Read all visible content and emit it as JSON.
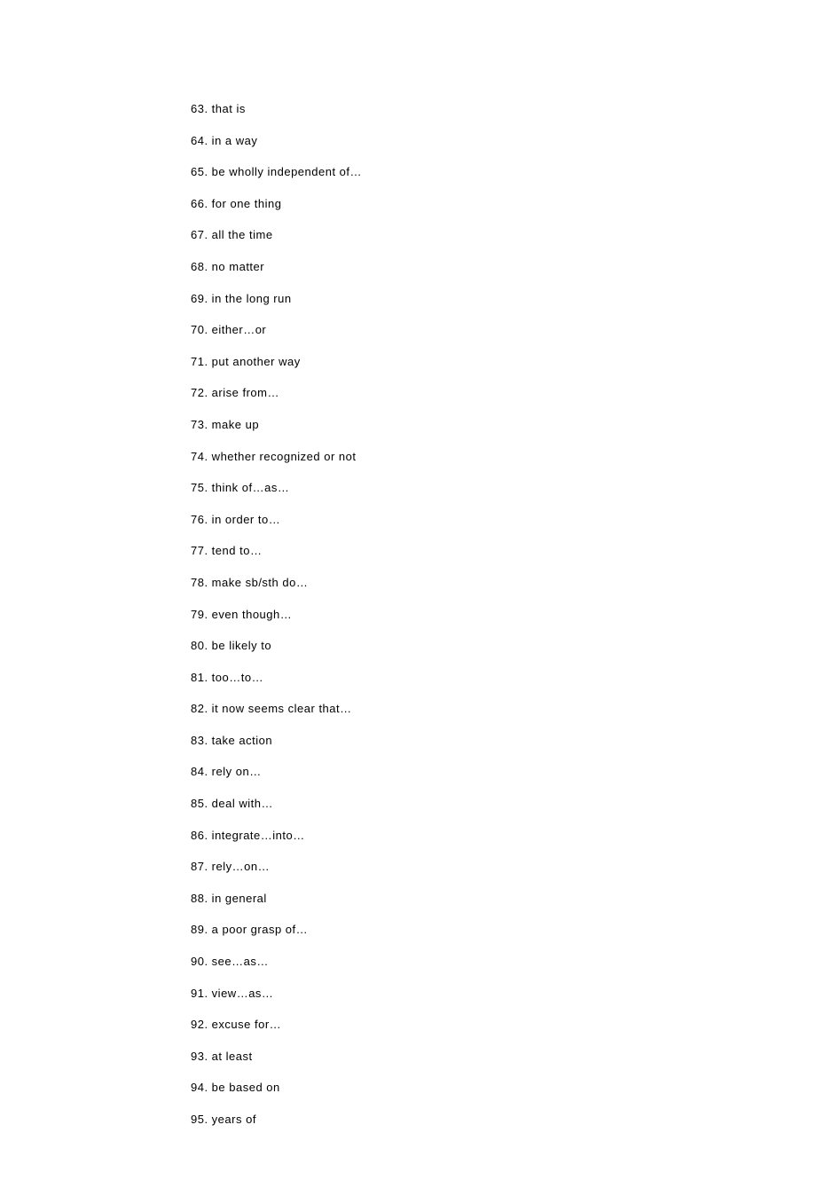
{
  "start_number": 63,
  "items": [
    "that is",
    "in a way",
    "be wholly independent of…",
    "for one thing",
    "all the time",
    "no matter",
    "in the long run",
    "either…or",
    "put another way",
    "arise from…",
    "make up",
    "whether recognized or not",
    "think of…as…",
    "in order to…",
    "tend to…",
    "make sb/sth do…",
    "even though…",
    "be likely to",
    "too…to…",
    "it now seems clear that…",
    "take action",
    "rely on…",
    "deal with…",
    "integrate…into…",
    "rely…on…",
    "in general",
    "a poor grasp of…",
    "see…as…",
    "view…as…",
    "excuse for…",
    "at least",
    "be based on",
    "years of"
  ]
}
